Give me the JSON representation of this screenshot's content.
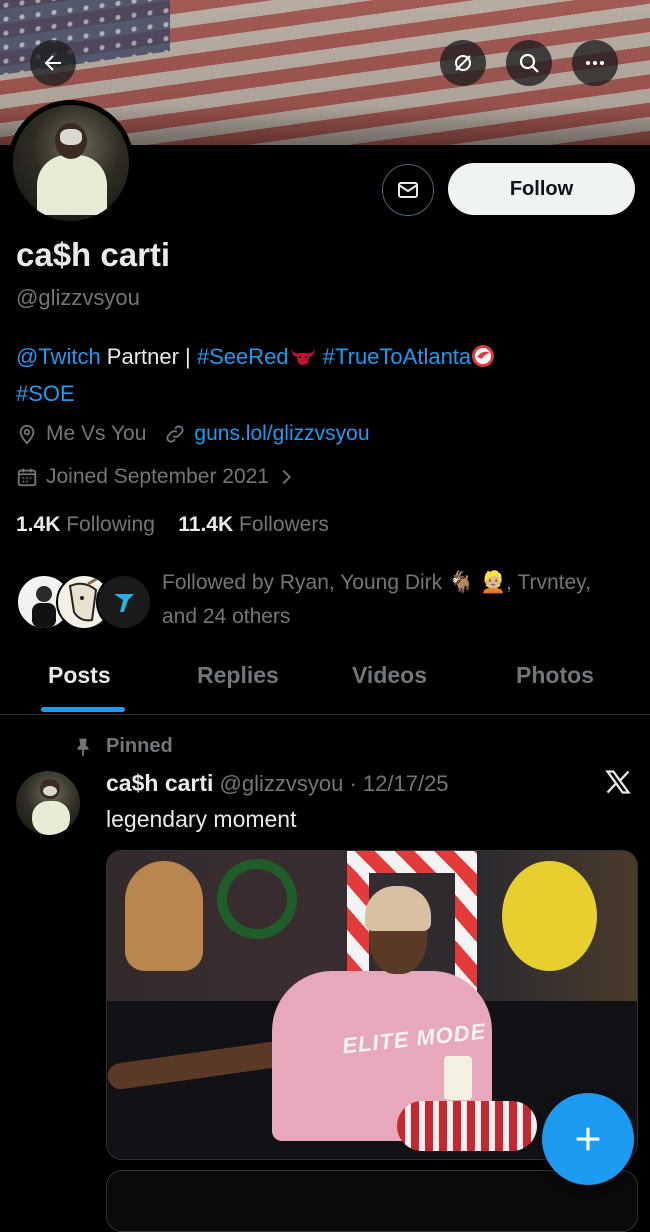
{
  "profile": {
    "name": "ca$h carti",
    "handle": "@glizzvsyou",
    "bio": {
      "twitch": "@Twitch",
      "partner": " Partner | ",
      "seered": "#SeeRed",
      "truetoatlanta": "#TrueToAtlanta",
      "soe": "#SOE"
    },
    "location": "Me Vs You",
    "website": "guns.lol/glizzvsyou",
    "joined": "Joined September 2021",
    "following_count": "1.4K",
    "following_label": "Following",
    "followers_count": "11.4K",
    "followers_label": "Followers",
    "followed_by": "Followed by Ryan, Young Dirk 🐐 👱🏼, Trvntey, and 24 others"
  },
  "actions": {
    "follow_label": "Follow",
    "message_icon": "envelope-icon"
  },
  "header_icons": [
    "back-arrow-icon",
    "grok-icon",
    "search-icon",
    "more-icon"
  ],
  "tabs": [
    {
      "label": "Posts",
      "active": true
    },
    {
      "label": "Replies",
      "active": false
    },
    {
      "label": "Videos",
      "active": false
    },
    {
      "label": "Photos",
      "active": false
    }
  ],
  "post": {
    "pinned_label": "Pinned",
    "author": "ca$h carti",
    "handle_time": "@glizzvsyou · 12/17/25",
    "text": "legendary moment",
    "media_caption": "ELITE MODE"
  },
  "colors": {
    "accent": "#1d9bf0",
    "background": "#000000",
    "text": "#e7e9ea",
    "muted": "#71767b"
  }
}
